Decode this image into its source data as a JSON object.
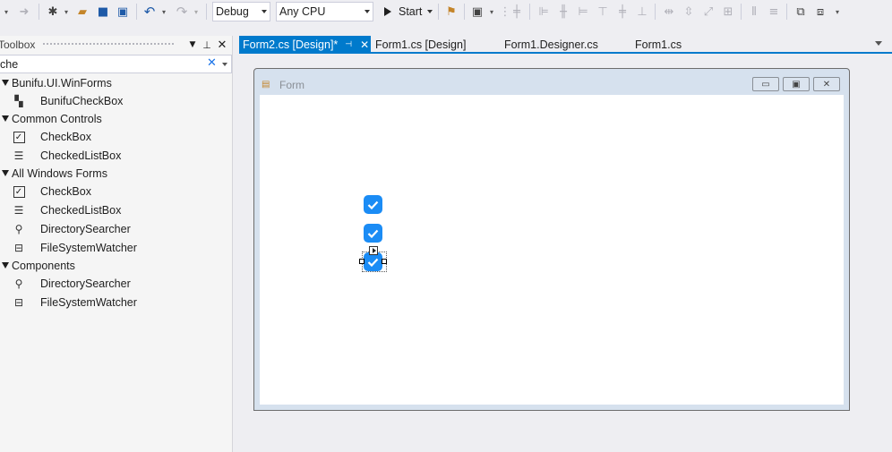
{
  "toolbar": {
    "config": "Debug",
    "platform": "Any CPU",
    "start_label": "Start",
    "icons": [
      "back-icon",
      "forward-icon",
      "new-project-icon",
      "open-icon",
      "save-icon",
      "save-all-icon",
      "undo-icon",
      "redo-icon",
      "find-icon",
      "align-icons",
      "layout-icons"
    ]
  },
  "toolbox": {
    "title": "Toolbox",
    "search_value": "che",
    "groups": [
      {
        "label": "Bunifu.UI.WinForms",
        "items": [
          {
            "label": "BunifuCheckBox",
            "icon": "bunifu-checkbox-icon"
          }
        ]
      },
      {
        "label": "Common Controls",
        "items": [
          {
            "label": "CheckBox",
            "icon": "checkbox-icon"
          },
          {
            "label": "CheckedListBox",
            "icon": "checked-list-icon"
          }
        ]
      },
      {
        "label": "All Windows Forms",
        "items": [
          {
            "label": "CheckBox",
            "icon": "checkbox-icon"
          },
          {
            "label": "CheckedListBox",
            "icon": "checked-list-icon"
          },
          {
            "label": "DirectorySearcher",
            "icon": "search-icon"
          },
          {
            "label": "FileSystemWatcher",
            "icon": "watcher-icon"
          }
        ]
      },
      {
        "label": "Components",
        "items": [
          {
            "label": "DirectorySearcher",
            "icon": "search-icon"
          },
          {
            "label": "FileSystemWatcher",
            "icon": "watcher-icon"
          }
        ]
      }
    ]
  },
  "tabs": [
    {
      "label": "Form2.cs [Design]*",
      "active": true
    },
    {
      "label": "Form1.cs [Design]",
      "active": false
    },
    {
      "label": "Form1.Designer.cs",
      "active": false
    },
    {
      "label": "Form1.cs",
      "active": false
    }
  ],
  "designer": {
    "form_title": "Form",
    "checkboxes": [
      {
        "checked": true
      },
      {
        "checked": true
      },
      {
        "checked": true,
        "selected": true
      }
    ]
  },
  "colors": {
    "accent": "#007acc",
    "checkbox": "#1b8cf5"
  }
}
